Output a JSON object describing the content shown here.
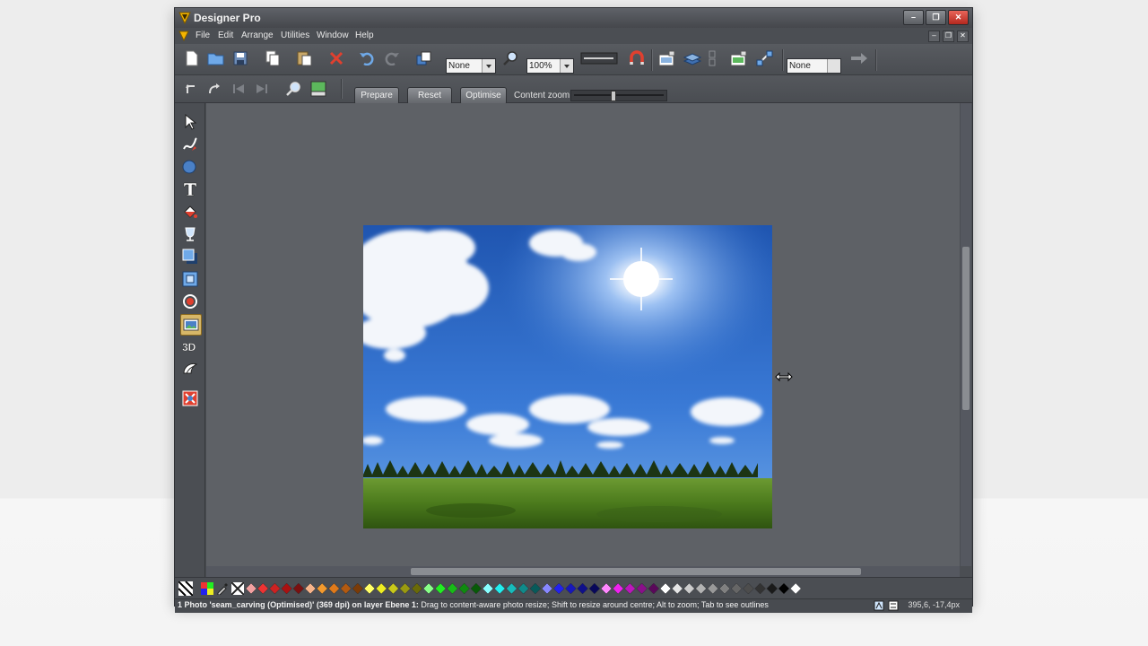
{
  "window": {
    "title": "Designer Pro"
  },
  "menu": [
    "File",
    "Edit",
    "Arrange",
    "Utilities",
    "Window",
    "Help"
  ],
  "toolbar": {
    "quality_combo": "None",
    "zoom_combo": "100%",
    "bitmap_combo": "None"
  },
  "photo_toolbar": {
    "prepare_label": "Prepare",
    "reset_label": "Reset",
    "optimise_label": "Optimise",
    "content_zoom_label": "Content zoom:"
  },
  "status": {
    "selection": "1 Photo 'seam_carving (Optimised)' (369 dpi) on layer Ebene 1:",
    "hint": " Drag to content-aware photo resize; Shift to resize around centre; Alt to zoom; Tab to see outlines",
    "coords": "395,6, -17,4px"
  },
  "palette_colors": [
    "#f2a0a0",
    "#e33",
    "#c22",
    "#a11",
    "#7a1010",
    "#f6b38a",
    "#f39a2e",
    "#e07a1a",
    "#b35a10",
    "#7a3b08",
    "#ffff66",
    "#eeee22",
    "#c9c91a",
    "#9a9a10",
    "#6a6a08",
    "#88ff88",
    "#22ee22",
    "#18bb18",
    "#108a10",
    "#085a08",
    "#88ffff",
    "#22eeee",
    "#18bbbb",
    "#108a8a",
    "#085a5a",
    "#8888ff",
    "#2222ee",
    "#1818bb",
    "#10108a",
    "#08085a",
    "#ff88ff",
    "#ee22ee",
    "#bb18bb",
    "#8a108a",
    "#5a085a",
    "#ffffff",
    "#e6e6e6",
    "#cccccc",
    "#b3b3b3",
    "#999999",
    "#808080",
    "#666666",
    "#4d4d4d",
    "#333333",
    "#1a1a1a",
    "#000000",
    "#ffffff"
  ]
}
